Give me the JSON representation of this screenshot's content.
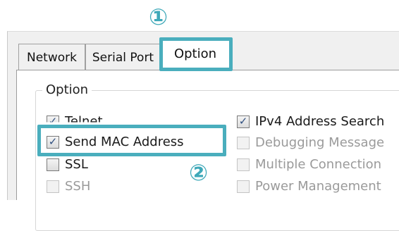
{
  "annotations": {
    "marker_1": "①",
    "marker_2": "②"
  },
  "tabs": [
    {
      "label": "Network",
      "active": false
    },
    {
      "label": "Serial Port",
      "active": false
    },
    {
      "label": "Option",
      "active": true
    }
  ],
  "group": {
    "title": "Option"
  },
  "options": {
    "left": [
      {
        "label": "Telnet",
        "checked": true,
        "enabled": true
      },
      {
        "label": "Send MAC Address",
        "checked": true,
        "enabled": true
      },
      {
        "label": "SSL",
        "checked": false,
        "enabled": true
      },
      {
        "label": "SSH",
        "checked": false,
        "enabled": false
      }
    ],
    "right": [
      {
        "label": "IPv4 Address Search",
        "checked": true,
        "enabled": true
      },
      {
        "label": "Debugging Message",
        "checked": false,
        "enabled": false
      },
      {
        "label": "Multiple Connection",
        "checked": false,
        "enabled": false
      },
      {
        "label": "Power Management",
        "checked": false,
        "enabled": false
      }
    ]
  },
  "check_glyph": "✓",
  "colors": {
    "highlight": "#4aaebd",
    "marker": "#3fa9b9",
    "check": "#2f4f7f"
  }
}
